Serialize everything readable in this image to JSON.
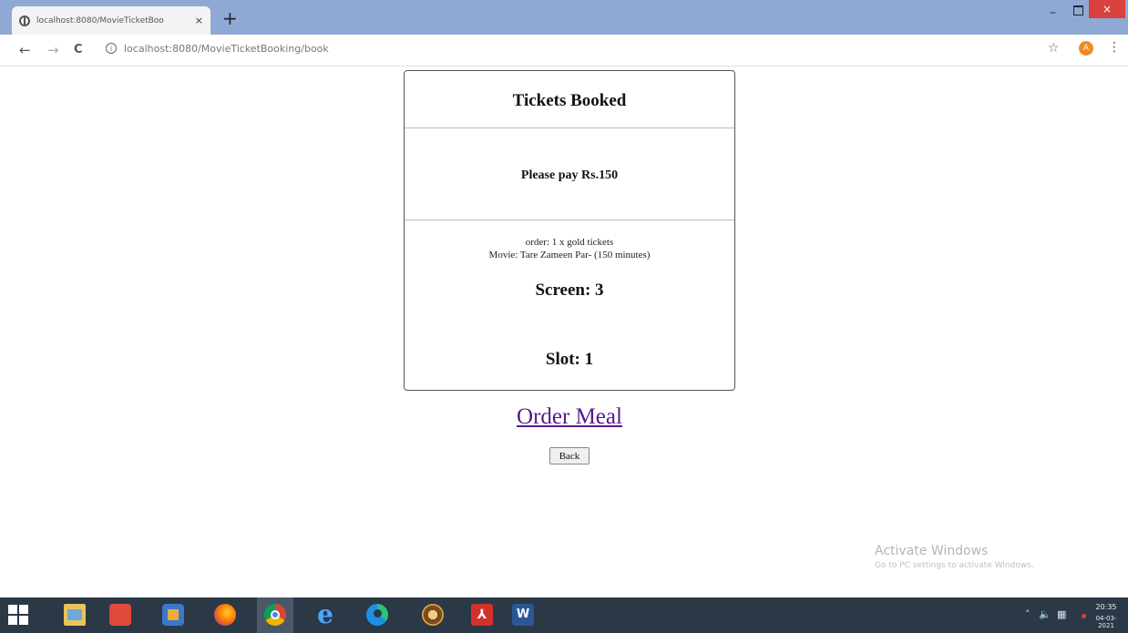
{
  "browser": {
    "tab_title": "localhost:8080/MovieTicketBoo",
    "tab_close": "×",
    "new_tab": "+",
    "url": "localhost:8080/MovieTicketBooking/book",
    "window_controls": {
      "minimize": "–",
      "close": "×"
    },
    "nav": {
      "back": "←",
      "forward": "→",
      "reload": "C"
    },
    "profile_initial": "A"
  },
  "booking": {
    "title": "Tickets Booked",
    "payment": "Please pay Rs.150",
    "order": "order: 1 x gold tickets",
    "movie": "Movie: Tare Zameen Par- (150 minutes)",
    "screen": "Screen: 3",
    "slot": "Slot: 1"
  },
  "actions": {
    "order_meal": "Order Meal",
    "back": "Back"
  },
  "watermark": {
    "title": "Activate Windows",
    "subtitle": "Go to PC settings to activate Windows."
  },
  "taskbar": {
    "time": "20:35",
    "date": "04-03-2021",
    "word_label": "W"
  },
  "colors": {
    "title_bar": "#8fa9d4",
    "link_visited": "#551a8b",
    "taskbar": "#2b3846",
    "close_button": "#d8413e"
  }
}
